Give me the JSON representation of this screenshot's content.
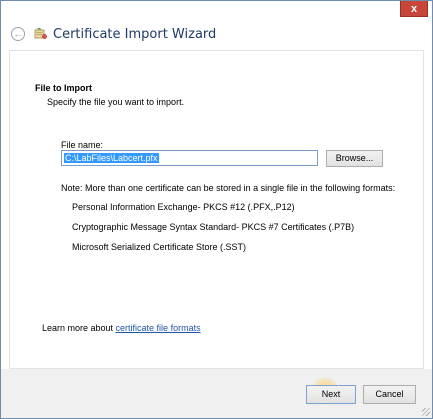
{
  "window": {
    "title": "Certificate Import Wizard",
    "close_glyph": "x"
  },
  "page": {
    "heading": "File to Import",
    "subheading": "Specify the file you want to import."
  },
  "file": {
    "label": "File name:",
    "value": "C:\\LabFiles\\Labcert.pfx",
    "browse_label": "Browse..."
  },
  "note": "Note:  More than one certificate can be stored in a single file in the following formats:",
  "formats": [
    "Personal Information Exchange- PKCS #12 (.PFX,.P12)",
    "Cryptographic Message Syntax Standard- PKCS #7 Certificates (.P7B)",
    "Microsoft Serialized Certificate Store (.SST)"
  ],
  "learn_more": {
    "prefix": "Learn more about ",
    "link": "certificate file formats"
  },
  "footer": {
    "next_label": "Next",
    "cancel_label": "Cancel"
  },
  "icons": {
    "back": "back-arrow-icon",
    "wizard": "certificate-wizard-icon"
  },
  "colors": {
    "title_text": "#1c3a63",
    "link": "#1f55a8",
    "selection": "#3399ff",
    "close_button": "#c7463a"
  }
}
